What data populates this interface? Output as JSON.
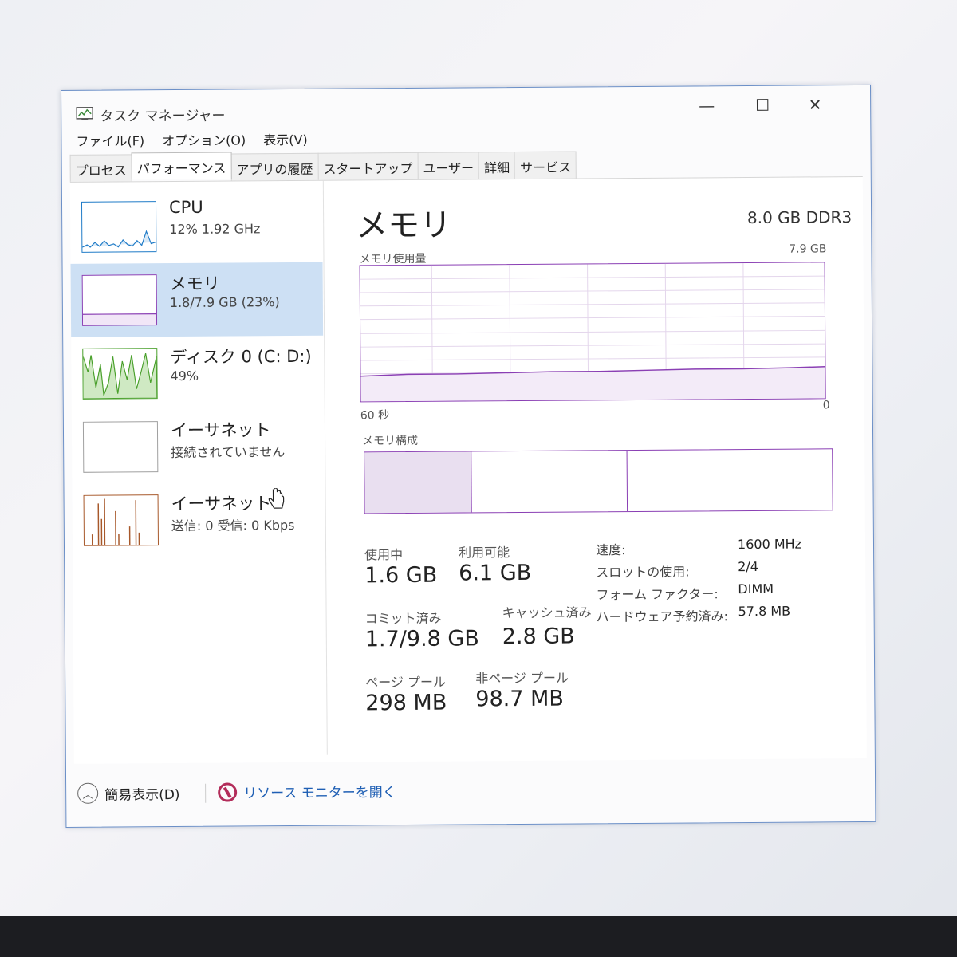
{
  "window": {
    "title": "タスク マネージャー",
    "controls": {
      "minimize": "—",
      "maximize": "☐",
      "close": "✕"
    }
  },
  "menu": [
    "ファイル(F)",
    "オプション(O)",
    "表示(V)"
  ],
  "tabs": [
    "プロセス",
    "パフォーマンス",
    "アプリの履歴",
    "スタートアップ",
    "ユーザー",
    "詳細",
    "サービス"
  ],
  "active_tab_index": 1,
  "sidebar": [
    {
      "title": "CPU",
      "subtitle": "12% 1.92 GHz",
      "color": "#1f7bc7"
    },
    {
      "title": "メモリ",
      "subtitle": "1.8/7.9 GB (23%)",
      "color": "#8a3fb4",
      "selected": true
    },
    {
      "title": "ディスク 0 (C: D:)",
      "subtitle": "49%",
      "color": "#4aa02c"
    },
    {
      "title": "イーサネット",
      "subtitle": "接続されていません",
      "color": "#a0a0a0"
    },
    {
      "title": "イーサネット",
      "subtitle": "送信: 0 受信: 0 Kbps",
      "color": "#a7582a"
    }
  ],
  "main": {
    "title": "メモリ",
    "spec": "8.0 GB DDR3",
    "usage_label": "メモリ使用量",
    "usage_max": "7.9 GB",
    "time_left": "60 秒",
    "time_right": "0",
    "composition_label": "メモリ構成",
    "stats": {
      "in_use_label": "使用中",
      "in_use": "1.6 GB",
      "available_label": "利用可能",
      "available": "6.1 GB",
      "committed_label": "コミット済み",
      "committed": "1.7/9.8 GB",
      "cached_label": "キャッシュ済み",
      "cached": "2.8 GB",
      "paged_label": "ページ プール",
      "paged": "298 MB",
      "nonpaged_label": "非ページ プール",
      "nonpaged": "98.7 MB"
    },
    "details": [
      {
        "label": "速度:",
        "value": "1600 MHz"
      },
      {
        "label": "スロットの使用:",
        "value": "2/4"
      },
      {
        "label": "フォーム ファクター:",
        "value": "DIMM"
      },
      {
        "label": "ハードウェア予約済み:",
        "value": "57.8 MB"
      }
    ]
  },
  "footer": {
    "simple_view": "簡易表示(D)",
    "resource_monitor": "リソース モニターを開く"
  },
  "colors": {
    "memory": "#8a3fb4",
    "selection": "#cde0f4",
    "link": "#1f5fb4"
  }
}
